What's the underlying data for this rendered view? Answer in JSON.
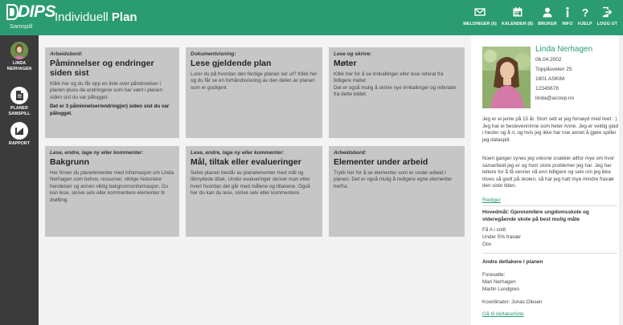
{
  "brand": {
    "logo": "DIPS",
    "sub": "Samspill",
    "title_prefix": "Individuell",
    "title_bold": "Plan"
  },
  "topnav": [
    {
      "icon": "mail-icon",
      "label": "MELDINGER (6)"
    },
    {
      "icon": "calendar-icon",
      "label": "KALENDER (8)"
    },
    {
      "icon": "user-icon",
      "label": "BRUKER"
    },
    {
      "icon": "info-icon",
      "label": "INFO"
    },
    {
      "icon": "help-icon",
      "label": "HJELP"
    },
    {
      "icon": "logout-icon",
      "label": "LOGG UT"
    }
  ],
  "sidebar": [
    {
      "icon": "avatar-icon",
      "label1": "LINDA",
      "label2": "NERHAGEN"
    },
    {
      "icon": "document-icon",
      "label1": "PLANER",
      "label2": "SAMSPILL"
    },
    {
      "icon": "chart-icon",
      "label1": "RAPPORT",
      "label2": ""
    }
  ],
  "cards": [
    {
      "type": "Arbeidsbord:",
      "title": "Påminnelser og endringer siden sist",
      "body": "Klikk her og du får opp en liste over påminnelser i planen pluss de endringene som har vært i planen siden sist du var pålogget.",
      "extra": "Det er 3 påminnelser/endring(er) siden sist du var pålogget."
    },
    {
      "type": "Dokumentvisning:",
      "title": "Lese gjeldende plan",
      "body": "Lurer du på hvordan den ferdige planen ser ut? Klikk her og du får se en forhåndsvisning av den delen av planen som er godkjent",
      "extra": ""
    },
    {
      "type": "Lese og skrive:",
      "title": "Møter",
      "body": "Klikk her for å se innkallinger eller lese referat fra tidligere møter.\nDet er også mulig å skrive nye innkallinger og referater fra dette bildet.",
      "extra": ""
    },
    {
      "type": "Lese, endre, lage ny eller kommenter:",
      "title": "Bakgrunn",
      "body": "Her finner du planelementer med informasjon om Linda Nerhagen som behov, ressurser, viktige historiske hendelser og annen viktig bakgrunnsinformasjon. Du kan lese, skrive selv eller kommentere elementer til drøfting.",
      "extra": ""
    },
    {
      "type": "Lese, endre, lage ny eller kommenter:",
      "title": "Mål, tiltak eller evalueringer",
      "body": "Selve planen består av planelementer med mål og tilknyttede tiltak. Under evalueringer skriver man etter hvert hvordan det går med målene og tiltakene. Også her du kan du lese, skrive selv eller kommentere.",
      "extra": ""
    },
    {
      "type": "Arbeidsbord:",
      "title": "Elementer under arbeid",
      "body": "Trykk her for å se elementer som er under arbeid i planen. Det er også mulig å redigere egne elementer herfra.",
      "extra": ""
    }
  ],
  "profile": {
    "name": "Linda Nerhagen",
    "birthdate": "06.04.2002",
    "street": "Toppåsveien 25",
    "city": "1801 ASKIM",
    "phone": "12345678",
    "email": "linda@acosip.no",
    "about1": "Jeg er ei jente på 15 år. Stort sett er jeg fornøyd med livet : ) Jeg har ei bestevenninne som heter Anne. Jeg er veldig glad i hester og å ri, og hvis jeg ikke har noe annet å gjøre spiller jeg dataspill.",
    "about2": "Noen ganger synes jeg voksne snakker altfor mye om hvor samarbeid jeg er og hvor store problemer jeg har. Jeg har lettere for å få venner nå enn tidligere og selv om jeg ikke trives så godt på skolen, så har jeg hatt mye mindre fravær den siste tiden.",
    "edit_link": "Rediger",
    "goal_heading": "Hovedmål: Gjennomføre ungdomsskole og videregående skole på best mulig måte",
    "goal_items": [
      "Få A i snitt",
      "Under 5% fravær",
      "Osv"
    ],
    "participants_heading": "Andre deltakere i planen",
    "participants": [
      "Foresatte:",
      "Mari Nerhagen",
      "Martin Lundgren"
    ],
    "coordinator": "Koordinator: Jonas Olesen",
    "participants_link": "Gå til deltakerliste"
  },
  "colors": {
    "accent": "#2b9b72",
    "sidebar": "#3b3b3b",
    "card": "#c6c6c6"
  }
}
